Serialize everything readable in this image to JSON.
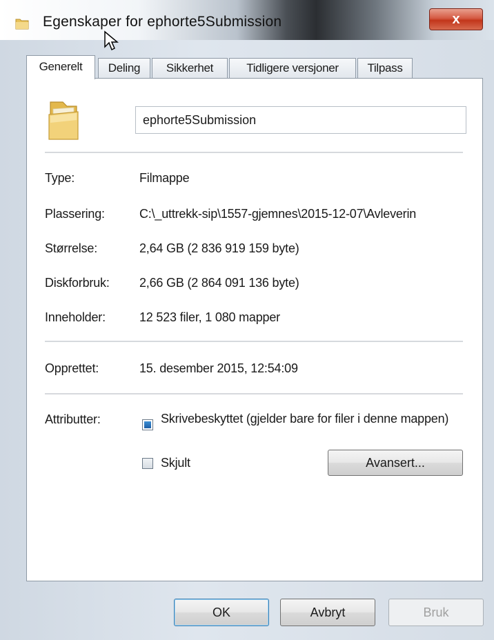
{
  "window": {
    "title": "Egenskaper for ephorte5Submission",
    "close_glyph": "x"
  },
  "tabs": [
    {
      "label": "Generelt",
      "active": true
    },
    {
      "label": "Deling",
      "active": false
    },
    {
      "label": "Sikkerhet",
      "active": false
    },
    {
      "label": "Tidligere versjoner",
      "active": false
    },
    {
      "label": "Tilpass",
      "active": false
    }
  ],
  "general": {
    "name_value": "ephorte5Submission",
    "rows": [
      {
        "label": "Type:",
        "value": "Filmappe"
      },
      {
        "label": "Plassering:",
        "value": "C:\\_uttrekk-sip\\1557-gjemnes\\2015-12-07\\Avleverin"
      },
      {
        "label": "Størrelse:",
        "value": "2,64 GB (2 836 919 159 byte)"
      },
      {
        "label": "Diskforbruk:",
        "value": "2,66 GB (2 864 091 136 byte)"
      },
      {
        "label": "Inneholder:",
        "value": "12 523 filer, 1 080 mapper"
      }
    ],
    "created": {
      "label": "Opprettet:",
      "value": "15. desember 2015, 12:54:09"
    },
    "attributes": {
      "label": "Attributter:",
      "readonly": {
        "label": "Skrivebeskyttet (gjelder bare for filer i denne mappen)",
        "state": "indeterminate"
      },
      "hidden": {
        "label": "Skjult",
        "checked": false
      },
      "advanced_label": "Avansert..."
    }
  },
  "buttons": {
    "ok": "OK",
    "cancel": "Avbryt",
    "apply": "Bruk"
  },
  "icons": {
    "title": "folder-icon",
    "folder": "folder-icon",
    "cursor": "mouse-cursor-icon"
  },
  "colors": {
    "close_button": "#c2361b",
    "checkbox_fill": "#1f5fa5",
    "folder_yellow": "#f2d27a"
  }
}
